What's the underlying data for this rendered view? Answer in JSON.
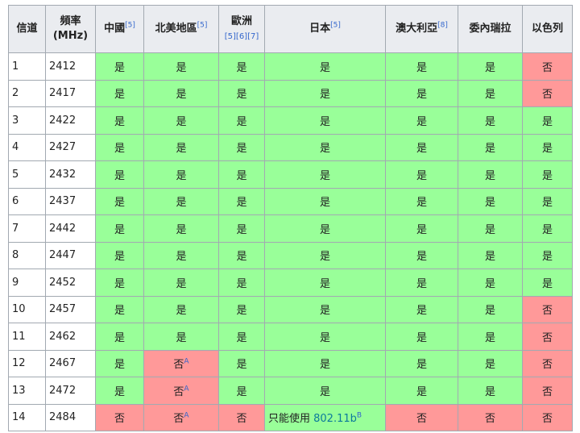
{
  "headers": [
    {
      "label": "信道",
      "refs": ""
    },
    {
      "label": "頻率",
      "label2": "(MHz)",
      "refs": ""
    },
    {
      "label": "中國",
      "refs": "[5]"
    },
    {
      "label": "北美地區",
      "refs": "[5]"
    },
    {
      "label": "歐洲",
      "refs_below": "[5][6][7]"
    },
    {
      "label": "日本",
      "refs": "[5]"
    },
    {
      "label": "澳大利亞",
      "refs": "[8]"
    },
    {
      "label": "委內瑞拉",
      "refs": ""
    },
    {
      "label": "以色列",
      "refs": ""
    }
  ],
  "rows": [
    {
      "channel": "1",
      "freq": "2412",
      "cells": [
        "是",
        "是",
        "是",
        "是",
        "是",
        "是",
        "否"
      ]
    },
    {
      "channel": "2",
      "freq": "2417",
      "cells": [
        "是",
        "是",
        "是",
        "是",
        "是",
        "是",
        "否"
      ]
    },
    {
      "channel": "3",
      "freq": "2422",
      "cells": [
        "是",
        "是",
        "是",
        "是",
        "是",
        "是",
        "是"
      ]
    },
    {
      "channel": "4",
      "freq": "2427",
      "cells": [
        "是",
        "是",
        "是",
        "是",
        "是",
        "是",
        "是"
      ]
    },
    {
      "channel": "5",
      "freq": "2432",
      "cells": [
        "是",
        "是",
        "是",
        "是",
        "是",
        "是",
        "是"
      ]
    },
    {
      "channel": "6",
      "freq": "2437",
      "cells": [
        "是",
        "是",
        "是",
        "是",
        "是",
        "是",
        "是"
      ]
    },
    {
      "channel": "7",
      "freq": "2442",
      "cells": [
        "是",
        "是",
        "是",
        "是",
        "是",
        "是",
        "是"
      ]
    },
    {
      "channel": "8",
      "freq": "2447",
      "cells": [
        "是",
        "是",
        "是",
        "是",
        "是",
        "是",
        "是"
      ]
    },
    {
      "channel": "9",
      "freq": "2452",
      "cells": [
        "是",
        "是",
        "是",
        "是",
        "是",
        "是",
        "是"
      ]
    },
    {
      "channel": "10",
      "freq": "2457",
      "cells": [
        "是",
        "是",
        "是",
        "是",
        "是",
        "是",
        "否"
      ]
    },
    {
      "channel": "11",
      "freq": "2462",
      "cells": [
        "是",
        "是",
        "是",
        "是",
        "是",
        "是",
        "否"
      ]
    },
    {
      "channel": "12",
      "freq": "2467",
      "cells": [
        "是",
        "否A",
        "是",
        "是",
        "是",
        "是",
        "否"
      ]
    },
    {
      "channel": "13",
      "freq": "2472",
      "cells": [
        "是",
        "否A",
        "是",
        "是",
        "是",
        "是",
        "否"
      ]
    },
    {
      "channel": "14",
      "freq": "2484",
      "cells": [
        "否",
        "否A",
        "否",
        "只能使用 802.11bB",
        "否",
        "否",
        "否"
      ]
    }
  ],
  "labels": {
    "yes": "是",
    "no": "否",
    "note_a": "A",
    "note_b": "B",
    "japan_ch14_prefix": "只能使用 ",
    "japan_ch14_link": "802.11b"
  },
  "colors": {
    "yes": "#99ff99",
    "no": "#ff9999",
    "header": "#eaecf0",
    "border": "#a2a9b1"
  }
}
